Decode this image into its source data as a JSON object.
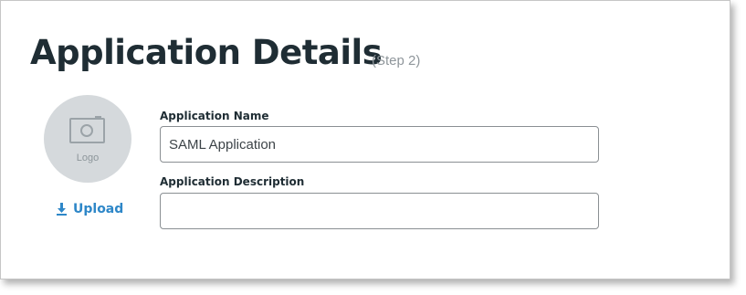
{
  "page": {
    "title": "Application Details",
    "step": "(Step 2)"
  },
  "logo": {
    "icon": "camera-icon",
    "label": "Logo"
  },
  "upload": {
    "icon": "download-icon",
    "label": "Upload"
  },
  "fields": {
    "name": {
      "label": "Application Name",
      "value": "SAML Application"
    },
    "description": {
      "label": "Application Description",
      "value": ""
    }
  },
  "colors": {
    "title": "#1f2d34",
    "accent": "#2e87c8",
    "logo_bg": "#d5d9dc"
  }
}
